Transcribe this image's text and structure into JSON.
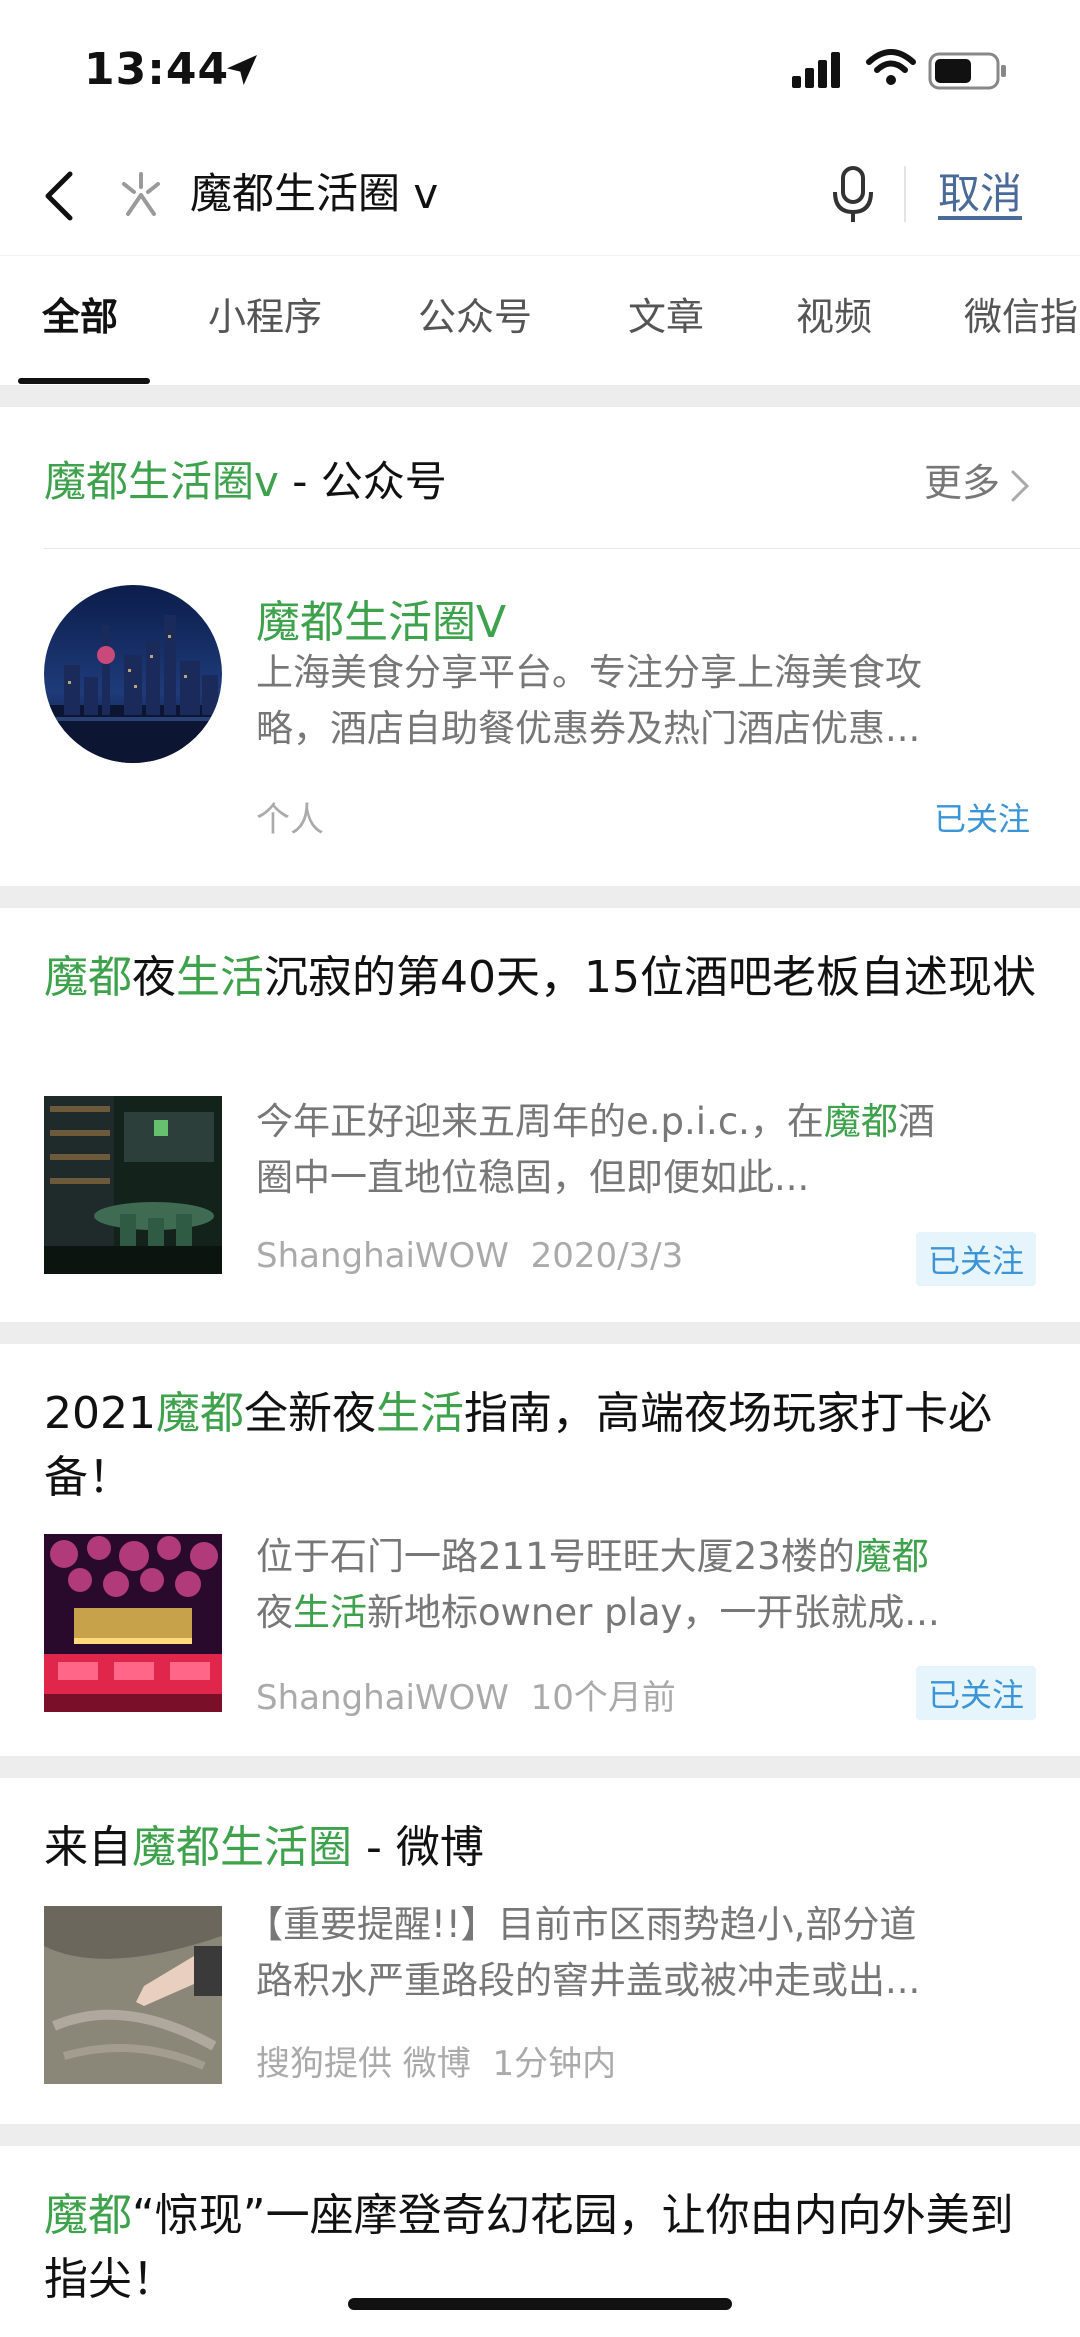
{
  "status_bar": {
    "time": "13:44"
  },
  "search": {
    "query": "魔都生活圈 v",
    "cancel_label": "取消"
  },
  "tabs": [
    {
      "label": "全部",
      "active": true
    },
    {
      "label": "小程序"
    },
    {
      "label": "公众号"
    },
    {
      "label": "文章"
    },
    {
      "label": "视频"
    },
    {
      "label": "微信指"
    }
  ],
  "account_section": {
    "header_name": "魔都生活圈v",
    "header_suffix": " - 公众号",
    "more_label": "更多",
    "account": {
      "name": "魔都生活圈V",
      "description_line1": "上海美食分享平台。专注分享上海美食攻",
      "description_line2": "略，酒店自助餐优惠券及热门酒店优惠...",
      "type": "个人",
      "follow_status": "已关注"
    }
  },
  "articles": [
    {
      "title_parts": [
        {
          "text": "魔都",
          "hl": true
        },
        {
          "text": "夜",
          "hl": false
        },
        {
          "text": "生活",
          "hl": true
        },
        {
          "text": "沉寂的第40天，15位酒吧老板自述现状",
          "hl": false
        }
      ],
      "snippet_line1": "今年正好迎来五周年的e.p.i.c.，在魔都酒",
      "snippet_line2": "圈中一直地位稳固，但即便如此...",
      "source": "ShanghaiWOW",
      "date": "2020/3/3",
      "follow_status": "已关注"
    },
    {
      "title_parts": [
        {
          "text": "2021",
          "hl": false
        },
        {
          "text": "魔都",
          "hl": true
        },
        {
          "text": "全新夜",
          "hl": false
        },
        {
          "text": "生活",
          "hl": true
        },
        {
          "text": "指南，高端夜场玩家打卡必备！",
          "hl": false
        }
      ],
      "snippet_line1": "位于石门一路211号旺旺大厦23楼的魔都",
      "snippet_line2": "夜生活新地标owner play，一开张就成...",
      "source": "ShanghaiWOW",
      "date": "10个月前",
      "follow_status": "已关注"
    }
  ],
  "weibo_section": {
    "prefix": "来自",
    "name": "魔都生活圈",
    "suffix": " - 微博",
    "snippet_line1": "【重要提醒!!】目前市区雨势趋小,部分道",
    "snippet_line2": "路积水严重路段的窨井盖或被冲走或出...",
    "provider": "搜狗提供 微博",
    "time": "1分钟内"
  },
  "last_article": {
    "title_parts": [
      {
        "text": "魔都",
        "hl": true
      },
      {
        "text": "“惊现”一座摩登奇幻花园，让你由内向外美到指尖！",
        "hl": false
      }
    ]
  }
}
